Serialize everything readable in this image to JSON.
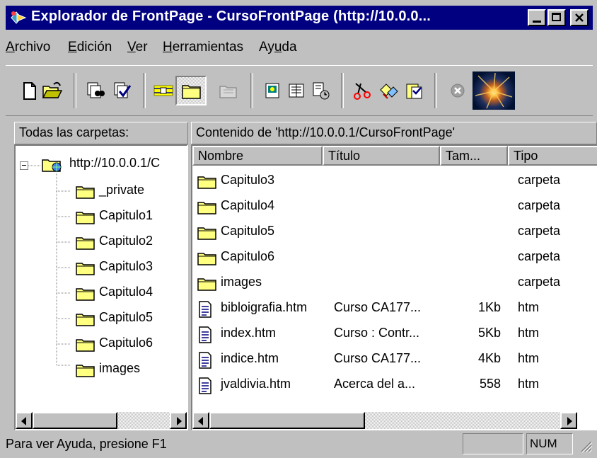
{
  "window": {
    "title": "Explorador de FrontPage - CursoFrontPage (http://10.0.0...",
    "buttons": [
      "minimize",
      "maximize",
      "close"
    ]
  },
  "menu": {
    "items": [
      {
        "label": "Archivo",
        "accel": "A"
      },
      {
        "label": "Edición",
        "accel": "E"
      },
      {
        "label": "Ver",
        "accel": "V"
      },
      {
        "label": "Herramientas",
        "accel": "H"
      },
      {
        "label": "Ayuda",
        "accel": "u"
      }
    ]
  },
  "toolbar": {
    "buttons": [
      "new-page-icon",
      "open-folder-icon",
      "find-icon",
      "spell-check-icon",
      "hyperlinks-view-icon",
      "folder-view-icon",
      "up-folder-icon",
      "frontpage-editor-icon",
      "image-editor-icon",
      "to-do-list-icon",
      "cut-icon",
      "copy-icon",
      "paste-icon",
      "stop-icon",
      "animated-logo-icon"
    ],
    "pressed": "folder-view-icon"
  },
  "left_pane": {
    "header": "Todas las carpetas:",
    "root": "http://10.0.0.1/C",
    "folders": [
      "_private",
      "Capitulo1",
      "Capitulo2",
      "Capitulo3",
      "Capitulo4",
      "Capitulo5",
      "Capitulo6",
      "images"
    ]
  },
  "right_pane": {
    "header": "Contenido de 'http://10.0.0.1/CursoFrontPage'",
    "columns": [
      "Nombre",
      "Título",
      "Tam...",
      "Tipo"
    ],
    "rows": [
      {
        "name": "Capitulo3",
        "title": "",
        "size": "",
        "type": "carpeta",
        "icon": "folder-icon"
      },
      {
        "name": "Capitulo4",
        "title": "",
        "size": "",
        "type": "carpeta",
        "icon": "folder-icon"
      },
      {
        "name": "Capitulo5",
        "title": "",
        "size": "",
        "type": "carpeta",
        "icon": "folder-icon"
      },
      {
        "name": "Capitulo6",
        "title": "",
        "size": "",
        "type": "carpeta",
        "icon": "folder-icon"
      },
      {
        "name": "images",
        "title": "",
        "size": "",
        "type": "carpeta",
        "icon": "folder-icon"
      },
      {
        "name": "bibloigrafia.htm",
        "title": "Curso CA177...",
        "size": "1Kb",
        "type": "htm",
        "icon": "html-file-icon"
      },
      {
        "name": "index.htm",
        "title": "Curso : Contr...",
        "size": "5Kb",
        "type": "htm",
        "icon": "html-file-icon"
      },
      {
        "name": "indice.htm",
        "title": "Curso CA177...",
        "size": "4Kb",
        "type": "htm",
        "icon": "html-file-icon"
      },
      {
        "name": "jvaldivia.htm",
        "title": "Acerca del a...",
        "size": "558",
        "type": "htm",
        "icon": "html-file-icon"
      }
    ]
  },
  "status": {
    "text": "Para ver Ayuda, presione F1",
    "num": "NUM"
  },
  "colors": {
    "titlebar": "#000080",
    "face": "#c0c0c0",
    "folder": "#ffff80"
  }
}
